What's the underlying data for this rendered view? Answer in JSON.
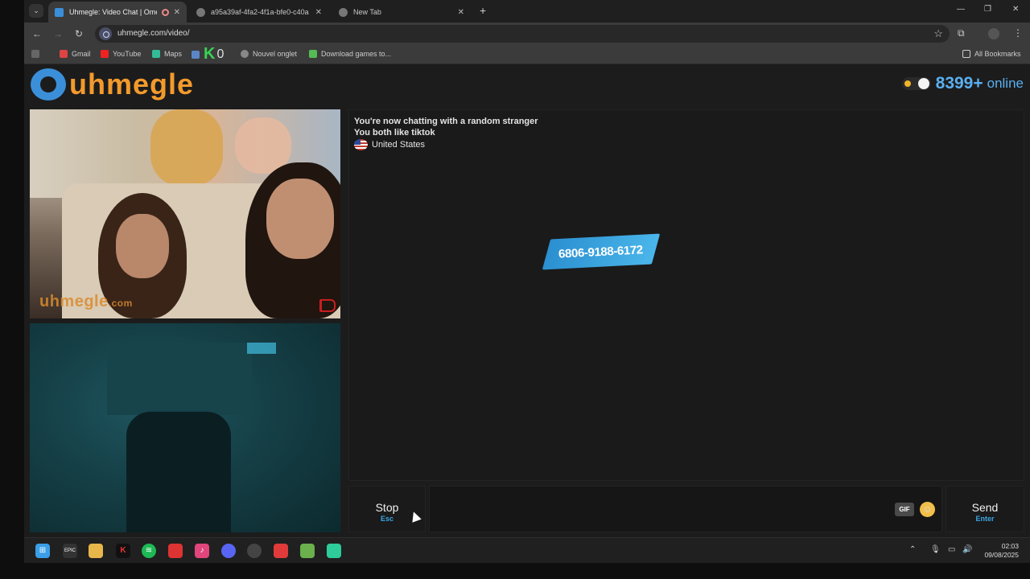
{
  "browser": {
    "tabs": [
      {
        "title": "Uhmegle: Video Chat | Omegle",
        "active": true
      },
      {
        "title": "a95a39af-4fa2-4f1a-bfe0-c40a",
        "active": false
      },
      {
        "title": "New Tab",
        "active": false
      }
    ],
    "url": "uhmegle.com/video/",
    "bookmarks": [
      "Gmail",
      "YouTube",
      "Maps",
      "0",
      "Nouvel onglet",
      "Download games to..."
    ],
    "all_bookmarks": "All Bookmarks"
  },
  "site": {
    "logo_text": "uhmegle",
    "online_count": "8399+",
    "online_label": "online"
  },
  "video": {
    "watermark": "uhmegle",
    "watermark_suffix": ".com"
  },
  "chat": {
    "messages": [
      "You're now chatting with a random stranger",
      "You both like tiktok"
    ],
    "country": "United States",
    "sticker_text": "6806-9188-6172"
  },
  "controls": {
    "stop_label": "Stop",
    "stop_key": "Esc",
    "gif_label": "GIF",
    "send_label": "Send",
    "send_key": "Enter"
  },
  "taskbar": {
    "time": "02:03",
    "date": "09/08/2025"
  },
  "colors": {
    "accent_blue": "#5ab0f0",
    "logo_orange": "#f39a2c",
    "key_blue": "#3aa7e6"
  }
}
